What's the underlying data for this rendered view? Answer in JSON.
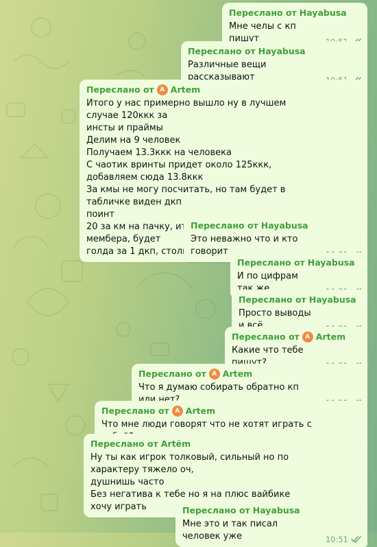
{
  "chat": {
    "forward_prefix": "Переслано от",
    "messages": [
      {
        "from": "Hayabusa",
        "has_avatar": false,
        "avatar_letter": "",
        "text": "Мне челы с кп пишут",
        "time": "10:51"
      },
      {
        "from": "Hayabusa",
        "has_avatar": false,
        "avatar_letter": "",
        "text": "Различные вещи рассказывают",
        "time": "10:51"
      },
      {
        "from": "Artem",
        "has_avatar": true,
        "avatar_letter": "A",
        "text": "Итого у нас примерно вышло ну в лучшем случае 120ккк за\nинсты и праймы\nДелим на 9 человек\nПолучаем 13.3ккк на человека\nС чаотик вринты придет около 125ккк, добавляем сюда 13.8ккк\nЗа кмы не могу посчитать, но там будет в табличке виден дкп\nпоинт\n20 за км на пачку, итого это 2.2 дкп пойнта на мембера, будет\nголда за 1 дкп, столько и на числю",
        "time": "10:51"
      },
      {
        "from": "Hayabusa",
        "has_avatar": false,
        "avatar_letter": "",
        "text": "Это неважно что и кто говорит",
        "time": "10:51"
      },
      {
        "from": "Hayabusa",
        "has_avatar": false,
        "avatar_letter": "",
        "text": "И по цифрам так же",
        "time": "10:51"
      },
      {
        "from": "Hayabusa",
        "has_avatar": false,
        "avatar_letter": "",
        "text": "Просто выводы и всё",
        "time": "10:51"
      },
      {
        "from": "Artem",
        "has_avatar": true,
        "avatar_letter": "A",
        "text": "Какие что тебе пишут?",
        "time": "10:51"
      },
      {
        "from": "Artem",
        "has_avatar": true,
        "avatar_letter": "A",
        "text": "Что я думаю собирать обратно кп или нет?",
        "time": "10:51"
      },
      {
        "from": "Artem",
        "has_avatar": true,
        "avatar_letter": "A",
        "text": "Что мне люди говорят что не хотят играть с тобой?",
        "time": "10:51"
      },
      {
        "from": "Artëm",
        "has_avatar": false,
        "avatar_letter": "",
        "text": "Ну ты как игрок толковый, сильный но по характеру тяжело оч,\nдушнишь часто\nБез негатива к тебе но я на плюс вайбике хочу играть",
        "time": "10:51"
      },
      {
        "from": "Hayabusa",
        "has_avatar": false,
        "avatar_letter": "",
        "text": "Мне это и так писал человек уже",
        "time": "10:51"
      }
    ]
  },
  "theme": {
    "bubble": "#effdde",
    "sender": "#3f9f3a",
    "time": "#6cad62",
    "avatar": "#f08a40"
  },
  "icons": {
    "read_status": "double-check-icon"
  }
}
